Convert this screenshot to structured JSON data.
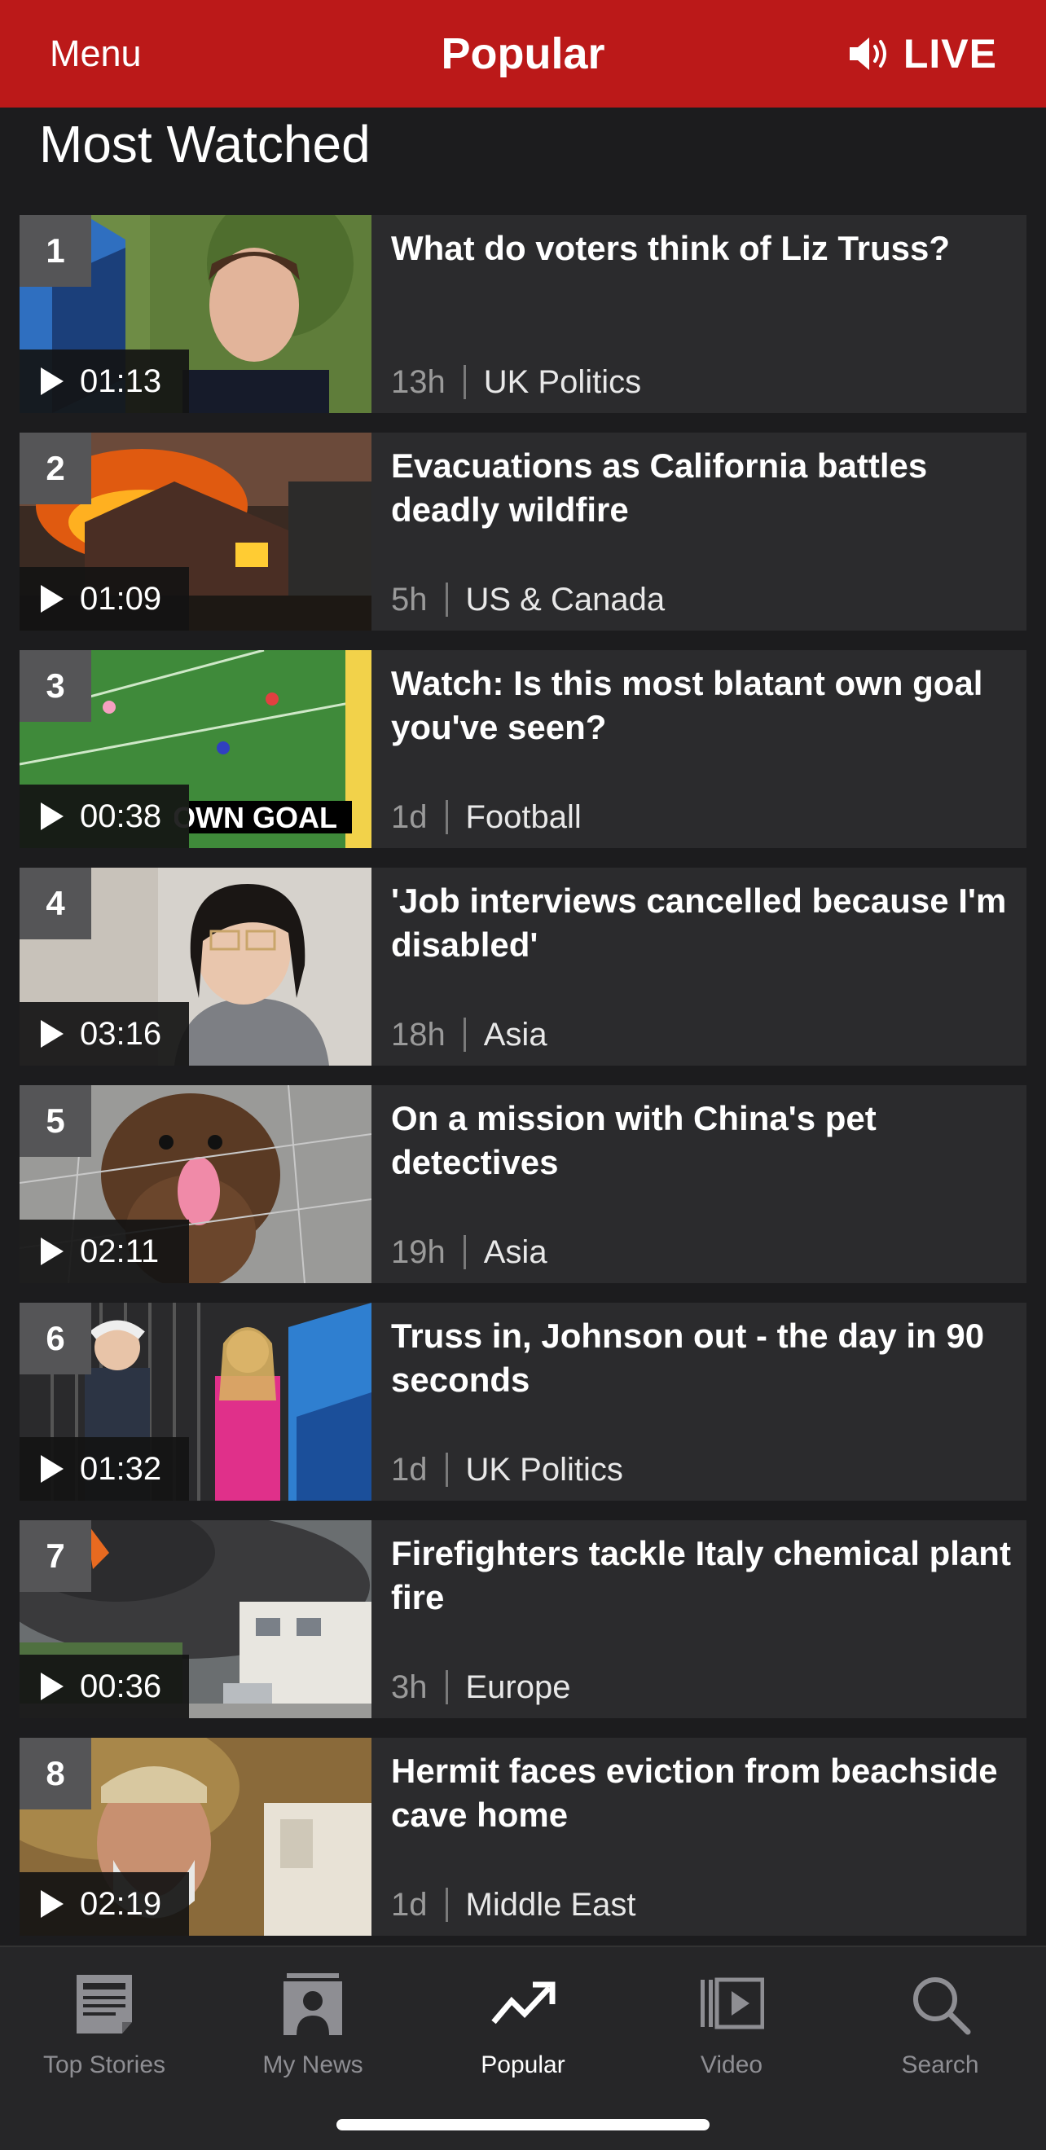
{
  "header": {
    "menu_label": "Menu",
    "title": "Popular",
    "live_label": "LIVE",
    "accent_color": "#bb1919"
  },
  "section": {
    "title": "Most Watched"
  },
  "items": [
    {
      "rank": "1",
      "duration": "01:13",
      "title": "What do voters think of Liz Truss?",
      "time": "13h",
      "category": "UK Politics"
    },
    {
      "rank": "2",
      "duration": "01:09",
      "title": "Evacuations as California battles deadly wildfire",
      "time": "5h",
      "category": "US & Canada"
    },
    {
      "rank": "3",
      "duration": "00:38",
      "title": "Watch: Is this most blatant own goal you've seen?",
      "time": "1d",
      "category": "Football",
      "thumb_caption": "OWN GOAL"
    },
    {
      "rank": "4",
      "duration": "03:16",
      "title": "'Job interviews cancelled because I'm disabled'",
      "time": "18h",
      "category": "Asia"
    },
    {
      "rank": "5",
      "duration": "02:11",
      "title": "On a mission with China's pet detectives",
      "time": "19h",
      "category": "Asia"
    },
    {
      "rank": "6",
      "duration": "01:32",
      "title": "Truss in, Johnson out - the day in 90 seconds",
      "time": "1d",
      "category": "UK Politics"
    },
    {
      "rank": "7",
      "duration": "00:36",
      "title": "Firefighters tackle Italy chemical plant fire",
      "time": "3h",
      "category": "Europe"
    },
    {
      "rank": "8",
      "duration": "02:19",
      "title": "Hermit faces eviction from beachside cave home",
      "time": "1d",
      "category": "Middle East"
    }
  ],
  "tabs": [
    {
      "label": "Top Stories",
      "icon": "newspaper-icon"
    },
    {
      "label": "My News",
      "icon": "person-news-icon"
    },
    {
      "label": "Popular",
      "icon": "trending-icon",
      "active": true
    },
    {
      "label": "Video",
      "icon": "video-icon"
    },
    {
      "label": "Search",
      "icon": "search-icon"
    }
  ]
}
